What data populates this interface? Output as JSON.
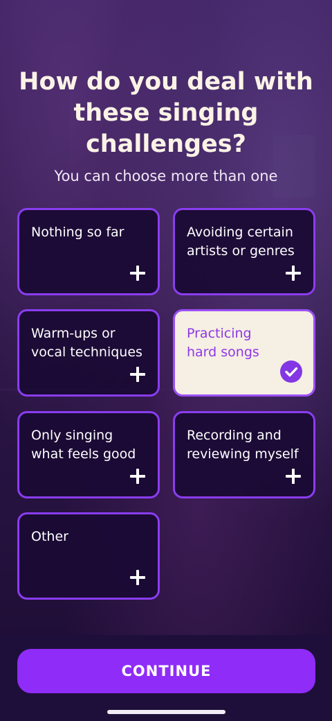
{
  "header": {
    "title": "How do you deal with these singing challenges?",
    "subtitle": "You can choose more than one"
  },
  "options": [
    {
      "label": "Nothing so far",
      "selected": false
    },
    {
      "label": "Avoiding certain\nartists or genres",
      "selected": false
    },
    {
      "label": "Warm-ups or\nvocal techniques",
      "selected": false
    },
    {
      "label": "Practicing\nhard songs",
      "selected": true
    },
    {
      "label": "Only singing\nwhat feels good",
      "selected": false
    },
    {
      "label": "Recording and\nreviewing myself",
      "selected": false
    },
    {
      "label": "Other",
      "selected": false
    }
  ],
  "icons": {
    "unselected": "plus-icon",
    "selected": "checkmark-circle-icon"
  },
  "footer": {
    "continue_label": "CONTINUE"
  },
  "colors": {
    "accent": "#8f2cf7",
    "card_border": "#8a3df0",
    "selected_card_bg": "#f6efe3",
    "selected_text": "#8e36e8",
    "title_text": "#fbf3e6"
  }
}
